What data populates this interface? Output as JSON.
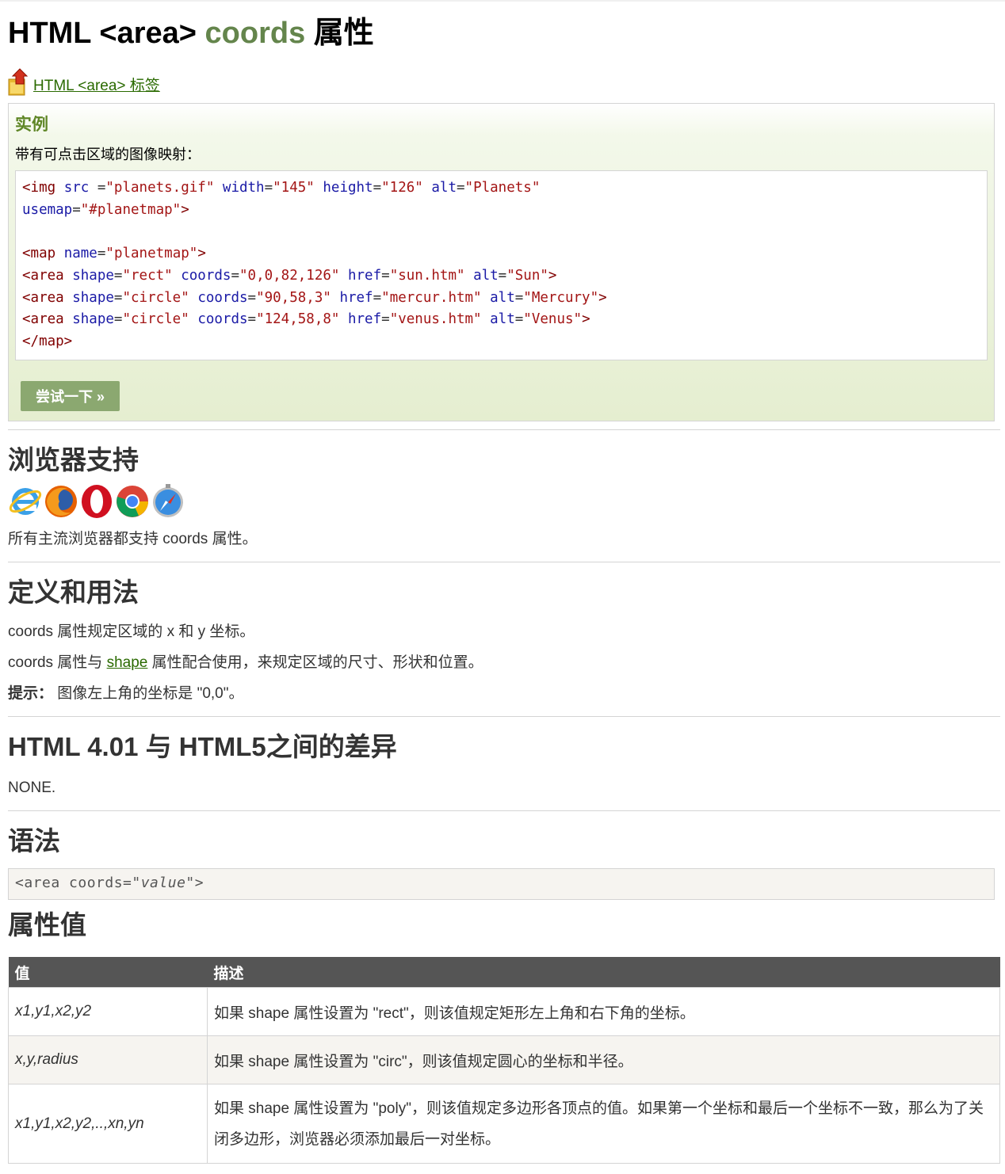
{
  "page": {
    "title_pre": "HTML <area> ",
    "title_hl": "coords",
    "title_post": " 属性",
    "back_link": "HTML <area> 标签"
  },
  "example": {
    "heading": "实例",
    "desc": "带有可点击区域的图像映射：",
    "try_button": "尝试一下 »"
  },
  "browser_support": {
    "heading": "浏览器支持",
    "icons": [
      "ie-icon",
      "firefox-icon",
      "opera-icon",
      "chrome-icon",
      "safari-icon"
    ],
    "text": "所有主流浏览器都支持 coords 属性。"
  },
  "definition": {
    "heading": "定义和用法",
    "p1": "coords 属性规定区域的 x 和 y 坐标。",
    "p2_pre": "coords 属性与 ",
    "p2_link": "shape",
    "p2_post": " 属性配合使用，来规定区域的尺寸、形状和位置。",
    "tip_label": "提示：",
    "tip_text": " 图像左上角的坐标是 \"0,0\"。"
  },
  "diff": {
    "heading": "HTML 4.01 与 HTML5之间的差异",
    "text": "NONE."
  },
  "syntax": {
    "heading": "语法",
    "pre": "<area coords=\"",
    "var": "value",
    "post": "\">"
  },
  "values": {
    "heading": "属性值",
    "col_value": "值",
    "col_desc": "描述",
    "rows": [
      {
        "value": "x1,y1,x2,y2",
        "desc": "如果 shape 属性设置为 \"rect\"，则该值规定矩形左上角和右下角的坐标。"
      },
      {
        "value": "x,y,radius",
        "desc": "如果 shape 属性设置为 \"circ\"，则该值规定圆心的坐标和半径。"
      },
      {
        "value": "x1,y1,x2,y2,..,xn,yn",
        "desc": "如果 shape 属性设置为 \"poly\"，则该值规定多边形各顶点的值。如果第一个坐标和最后一个坐标不一致，那么为了关闭多边形，浏览器必须添加最后一对坐标。"
      }
    ]
  },
  "colors": {
    "accent": "#64854c",
    "link": "#2a6a00",
    "button_bg": "#8ba870",
    "table_header_bg": "#555555"
  }
}
